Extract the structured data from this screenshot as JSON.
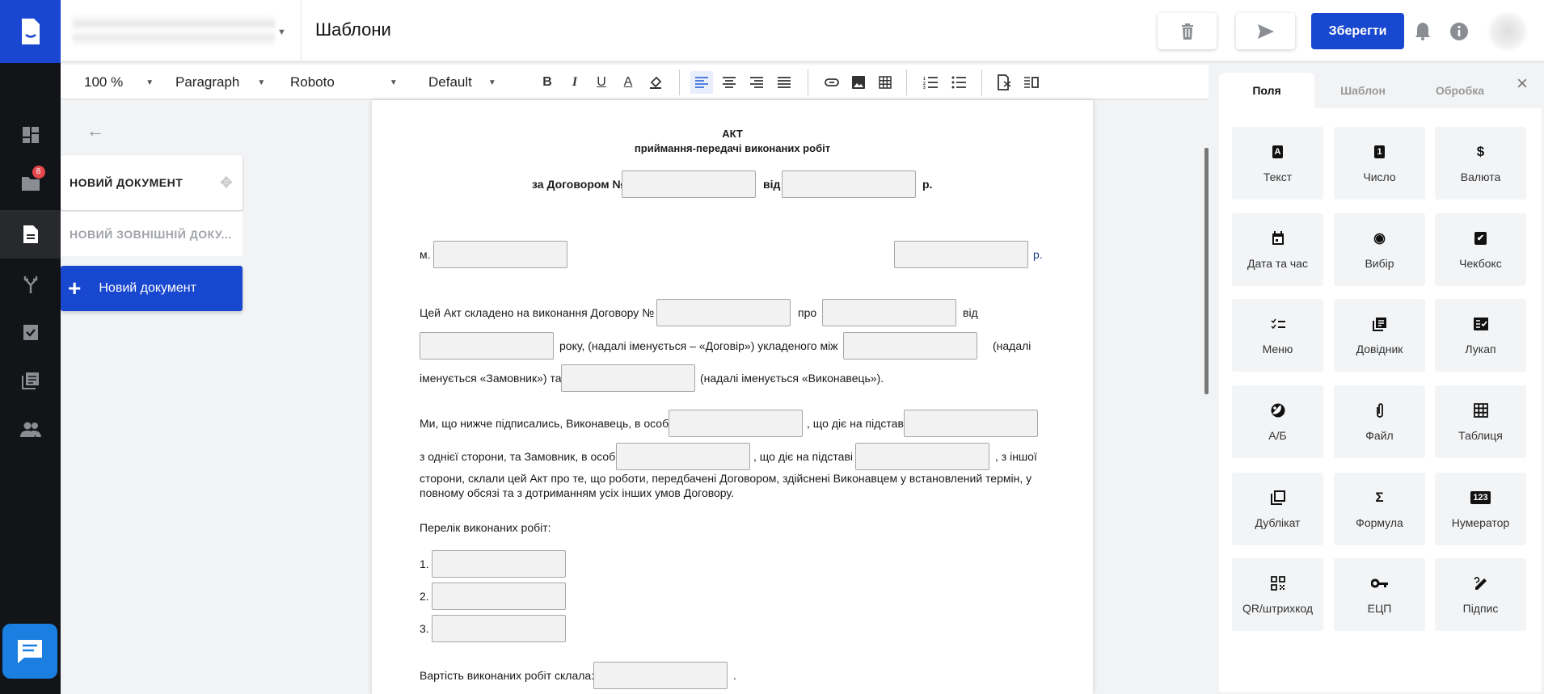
{
  "nav": {
    "badge_count": "8",
    "items": [
      "dashboard",
      "folders",
      "documents",
      "routes",
      "tasks",
      "directories",
      "users"
    ]
  },
  "header": {
    "title": "Шаблони",
    "save_label": "Зберегти"
  },
  "toolbar": {
    "zoom": "100 %",
    "block": "Paragraph",
    "font": "Roboto",
    "size": "Default",
    "bold": "B",
    "italic": "I",
    "underline": "U",
    "color": "A"
  },
  "left": {
    "items": [
      "НОВИЙ ДОКУМЕНТ",
      "НОВИЙ ЗОВНІШНІЙ ДОКУ..."
    ],
    "new_doc": "Новий документ",
    "plus": "+"
  },
  "doc": {
    "title": "АКТ",
    "subtitle": "приймання-передачі виконаних робіт",
    "l1a": "за Договором №",
    "l1b": "від",
    "l1c": "р.",
    "l2a": "м.",
    "l2b": "р.",
    "l3a": "Цей Акт складено на виконання Договору №",
    "l3b": "про",
    "l3c": "від",
    "l4a": "року, (надалі іменується – «Договір») укладеного між",
    "l4b": "(надалі",
    "l5a": "іменується «Замовник») та",
    "l5b": "(надалі іменується «Виконавець»).",
    "l6a": "Ми, що нижче підписались, Виконавець, в особі",
    "l6b": ", що діє на підставі",
    "l7a": "з однієї сторони, та Замовник, в особі",
    "l7b": ", що діє на підставі",
    "l7c": ", з іншої",
    "para": " сторони, склали цей Акт про те, що роботи, передбачені Договором, здійснені Виконавцем у встановлений термін, у повному обсязі та з дотриманням усіх інших умов Договору.",
    "list_title": "Перелік виконаних робіт:",
    "n1": "1.",
    "n2": "2.",
    "n3": "3.",
    "cost": "Вартість виконаних робіт склала:",
    "dot": "."
  },
  "panel": {
    "tabs": [
      "Поля",
      "Шаблон",
      "Обробка"
    ],
    "close": "×",
    "tiles": [
      {
        "label": "Текст",
        "icon": "A"
      },
      {
        "label": "Число",
        "icon": "1"
      },
      {
        "label": "Валюта",
        "icon": "$"
      },
      {
        "label": "Дата та час",
        "icon": "calendar"
      },
      {
        "label": "Вибір",
        "icon": "◉"
      },
      {
        "label": "Чекбокс",
        "icon": "✔"
      },
      {
        "label": "Меню",
        "icon": "checklist"
      },
      {
        "label": "Довідник",
        "icon": "library"
      },
      {
        "label": "Лукап",
        "icon": "lookup"
      },
      {
        "label": "А/Б",
        "icon": "ab"
      },
      {
        "label": "Файл",
        "icon": "paperclip"
      },
      {
        "label": "Таблиця",
        "icon": "table"
      },
      {
        "label": "Дублікат",
        "icon": "copy"
      },
      {
        "label": "Формула",
        "icon": "Σ"
      },
      {
        "label": "Нумератор",
        "icon": "123"
      },
      {
        "label": "QR/штрихкод",
        "icon": "qr"
      },
      {
        "label": "ЕЦП",
        "icon": "key"
      },
      {
        "label": "Підпис",
        "icon": "signature"
      }
    ]
  }
}
